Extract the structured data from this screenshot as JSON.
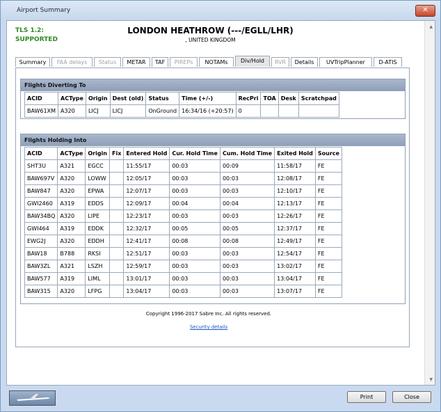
{
  "window": {
    "title": "Airport Summary",
    "close_glyph": "✕"
  },
  "header": {
    "tls_line1": "TLS 1.2:",
    "tls_line2": "SUPPORTED",
    "airport_name": "LONDON HEATHROW (---/EGLL/LHR)",
    "country": ", UNITED KINGDOM"
  },
  "tabs": [
    {
      "label": "Summary",
      "state": "normal"
    },
    {
      "label": "FAA delays",
      "state": "disabled"
    },
    {
      "label": "Status",
      "state": "disabled"
    },
    {
      "label": "METAR",
      "state": "normal"
    },
    {
      "label": "TAF",
      "state": "normal"
    },
    {
      "label": "PIREPs",
      "state": "disabled"
    },
    {
      "label": "NOTAMs",
      "state": "normal"
    },
    {
      "label": "Div/Hold",
      "state": "active"
    },
    {
      "label": "RVR",
      "state": "disabled"
    },
    {
      "label": "Details",
      "state": "normal"
    },
    {
      "label": "UVTripPlanner",
      "state": "normal"
    },
    {
      "label": "D-ATIS",
      "state": "normal"
    }
  ],
  "diverting": {
    "title": "Flights Diverting To",
    "columns": [
      "ACID",
      "ACType",
      "Origin",
      "Dest (old)",
      "Status",
      "Time (+/-)",
      "RecPri",
      "TOA",
      "Desk",
      "Scratchpad"
    ],
    "rows": [
      [
        "BAW61XM",
        "A320",
        "LICJ",
        "LICJ",
        "OnGround",
        "16:34/16 (+20:57)",
        "0",
        "",
        "",
        ""
      ]
    ]
  },
  "holding": {
    "title": "Flights Holding Into",
    "columns": [
      "ACID",
      "ACType",
      "Origin",
      "Fix",
      "Entered Hold",
      "Cur. Hold Time",
      "Cum. Hold Time",
      "Exited Hold",
      "Source"
    ],
    "rows": [
      [
        "SHT3U",
        "A321",
        "EGCC",
        "",
        "11:55/17",
        "00:03",
        "00:09",
        "11:58/17",
        "FE"
      ],
      [
        "BAW697V",
        "A320",
        "LOWW",
        "",
        "12:05/17",
        "00:03",
        "00:03",
        "12:08/17",
        "FE"
      ],
      [
        "BAW847",
        "A320",
        "EPWA",
        "",
        "12:07/17",
        "00:03",
        "00:03",
        "12:10/17",
        "FE"
      ],
      [
        "GWI2460",
        "A319",
        "EDDS",
        "",
        "12:09/17",
        "00:04",
        "00:04",
        "12:13/17",
        "FE"
      ],
      [
        "BAW34BQ",
        "A320",
        "LIPE",
        "",
        "12:23/17",
        "00:03",
        "00:03",
        "12:26/17",
        "FE"
      ],
      [
        "GWI464",
        "A319",
        "EDDK",
        "",
        "12:32/17",
        "00:05",
        "00:05",
        "12:37/17",
        "FE"
      ],
      [
        "EWG2J",
        "A320",
        "EDDH",
        "",
        "12:41/17",
        "00:08",
        "00:08",
        "12:49/17",
        "FE"
      ],
      [
        "BAW18",
        "B788",
        "RKSI",
        "",
        "12:51/17",
        "00:03",
        "00:03",
        "12:54/17",
        "FE"
      ],
      [
        "BAW3ZL",
        "A321",
        "LSZH",
        "",
        "12:59/17",
        "00:03",
        "00:03",
        "13:02/17",
        "FE"
      ],
      [
        "BAW577",
        "A319",
        "LIML",
        "",
        "13:01/17",
        "00:03",
        "00:03",
        "13:04/17",
        "FE"
      ],
      [
        "BAW315",
        "A320",
        "LFPG",
        "",
        "13:04/17",
        "00:03",
        "00:03",
        "13:07/17",
        "FE"
      ]
    ]
  },
  "footer": {
    "copyright": "Copyright 1996-2017 Sabre Inc. All rights reserved.",
    "security_link": "Security details"
  },
  "buttons": {
    "print": "Print",
    "close": "Close"
  }
}
